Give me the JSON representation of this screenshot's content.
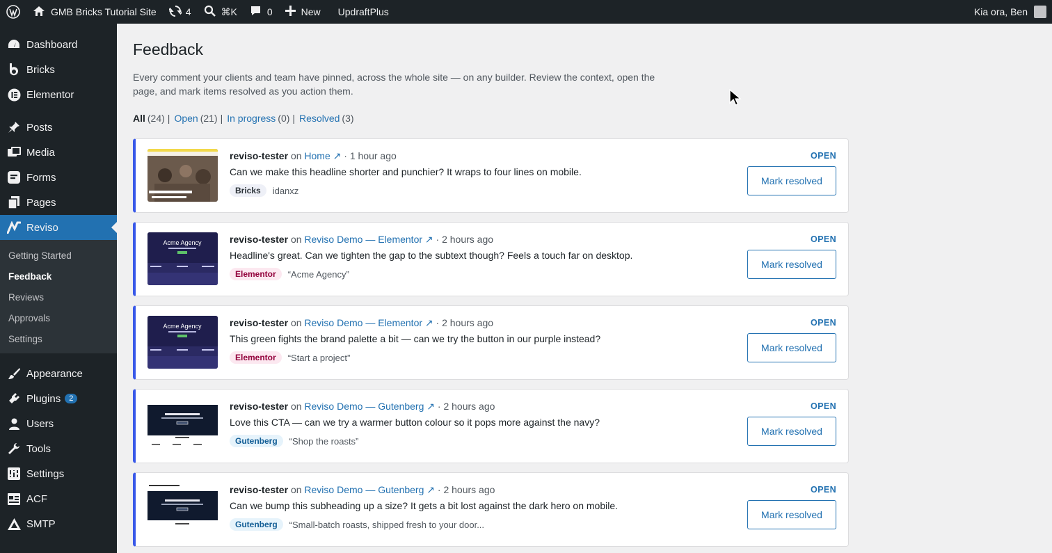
{
  "adminbar": {
    "site_name": "GMB Bricks Tutorial Site",
    "updates_count": "4",
    "search_shortcut": "⌘K",
    "comments_count": "0",
    "new_label": "New",
    "plugin_link": "UpdraftPlus",
    "greeting": "Kia ora, Ben"
  },
  "sidebar": {
    "items": [
      {
        "label": "Dashboard",
        "icon": "dashboard-icon"
      },
      {
        "label": "Bricks",
        "icon": "bricks-icon"
      },
      {
        "label": "Elementor",
        "icon": "elementor-icon"
      },
      {
        "label": "Posts",
        "icon": "pin-icon"
      },
      {
        "label": "Media",
        "icon": "media-icon"
      },
      {
        "label": "Forms",
        "icon": "forms-icon"
      },
      {
        "label": "Pages",
        "icon": "pages-icon"
      },
      {
        "label": "Reviso",
        "icon": "reviso-icon"
      },
      {
        "label": "Appearance",
        "icon": "brush-icon"
      },
      {
        "label": "Plugins",
        "icon": "plugin-icon",
        "badge": "2"
      },
      {
        "label": "Users",
        "icon": "user-icon"
      },
      {
        "label": "Tools",
        "icon": "wrench-icon"
      },
      {
        "label": "Settings",
        "icon": "settings-icon"
      },
      {
        "label": "ACF",
        "icon": "table-icon"
      },
      {
        "label": "SMTP",
        "icon": "smtp-icon"
      }
    ],
    "submenu": [
      "Getting Started",
      "Feedback",
      "Reviews",
      "Approvals",
      "Settings"
    ]
  },
  "page": {
    "title": "Feedback",
    "description": "Every comment your clients and team have pinned, across the whole site — on any builder. Review the context, open the page, and mark items resolved as you action them.",
    "filters": [
      {
        "label": "All",
        "count": "(24)"
      },
      {
        "label": "Open",
        "count": "(21)"
      },
      {
        "label": "In progress",
        "count": "(0)"
      },
      {
        "label": "Resolved",
        "count": "(3)"
      }
    ]
  },
  "feedback": [
    {
      "author": "reviso-tester",
      "on": "on",
      "page": "Home ↗",
      "time": "· 1 hour ago",
      "comment": "Can we make this headline shorter and punchier? It wraps to four lines on mobile.",
      "tag": "Bricks",
      "ref": "idanxz",
      "status": "OPEN",
      "action": "Mark resolved"
    },
    {
      "author": "reviso-tester",
      "on": "on",
      "page": "Reviso Demo — Elementor ↗",
      "time": "· 2 hours ago",
      "comment": "Headline's great. Can we tighten the gap to the subtext though? Feels a touch far on desktop.",
      "tag": "Elementor",
      "ref": "“Acme Agency”",
      "status": "OPEN",
      "action": "Mark resolved",
      "thumb_title": "Acme Agency"
    },
    {
      "author": "reviso-tester",
      "on": "on",
      "page": "Reviso Demo — Elementor ↗",
      "time": "· 2 hours ago",
      "comment": "This green fights the brand palette a bit — can we try the button in our purple instead?",
      "tag": "Elementor",
      "ref": "“Start a project”",
      "status": "OPEN",
      "action": "Mark resolved",
      "thumb_title": "Acme Agency"
    },
    {
      "author": "reviso-tester",
      "on": "on",
      "page": "Reviso Demo — Gutenberg ↗",
      "time": "· 2 hours ago",
      "comment": "Love this CTA — can we try a warmer button colour so it pops more against the navy?",
      "tag": "Gutenberg",
      "ref": "“Shop the roasts”",
      "status": "OPEN",
      "action": "Mark resolved"
    },
    {
      "author": "reviso-tester",
      "on": "on",
      "page": "Reviso Demo — Gutenberg ↗",
      "time": "· 2 hours ago",
      "comment": "Can we bump this subheading up a size? It gets a bit lost against the dark hero on mobile.",
      "tag": "Gutenberg",
      "ref": "“Small-batch roasts, shipped fresh to your door...",
      "status": "OPEN",
      "action": "Mark resolved"
    }
  ],
  "colors": {
    "accent": "#2271b1",
    "admin_dark": "#1d2327",
    "card_border": "#3858e9"
  }
}
